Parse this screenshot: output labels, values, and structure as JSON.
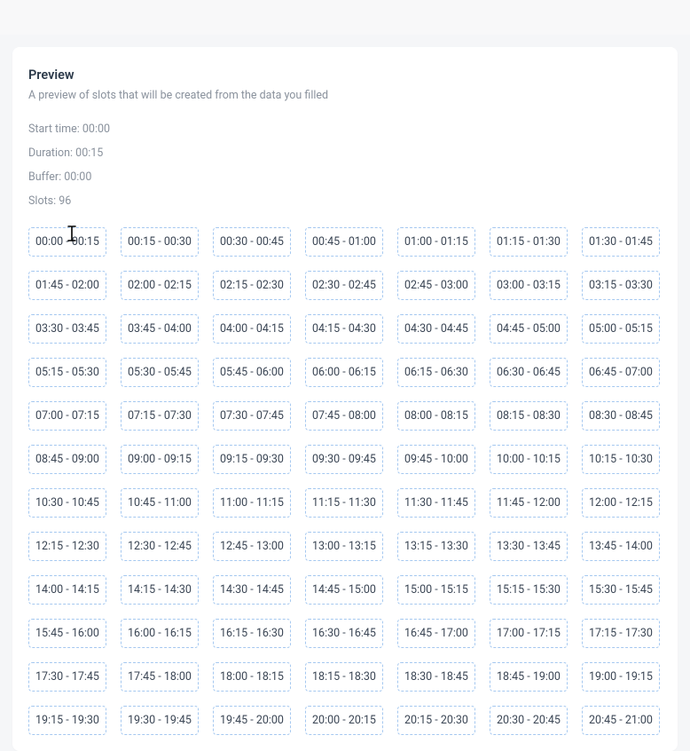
{
  "header": {
    "title": "Preview",
    "subtitle": "A preview of slots that will be created from the data you filled"
  },
  "meta": {
    "start_time_label": "Start time: 00:00",
    "duration_label": "Duration: 00:15",
    "buffer_label": "Buffer: 00:00",
    "slots_label": "Slots: 96"
  },
  "slots": [
    "00:00 - 00:15",
    "00:15 - 00:30",
    "00:30 - 00:45",
    "00:45 - 01:00",
    "01:00 - 01:15",
    "01:15 - 01:30",
    "01:30 - 01:45",
    "01:45 - 02:00",
    "02:00 - 02:15",
    "02:15 - 02:30",
    "02:30 - 02:45",
    "02:45 - 03:00",
    "03:00 - 03:15",
    "03:15 - 03:30",
    "03:30 - 03:45",
    "03:45 - 04:00",
    "04:00 - 04:15",
    "04:15 - 04:30",
    "04:30 - 04:45",
    "04:45 - 05:00",
    "05:00 - 05:15",
    "05:15 - 05:30",
    "05:30 - 05:45",
    "05:45 - 06:00",
    "06:00 - 06:15",
    "06:15 - 06:30",
    "06:30 - 06:45",
    "06:45 - 07:00",
    "07:00 - 07:15",
    "07:15 - 07:30",
    "07:30 - 07:45",
    "07:45 - 08:00",
    "08:00 - 08:15",
    "08:15 - 08:30",
    "08:30 - 08:45",
    "08:45 - 09:00",
    "09:00 - 09:15",
    "09:15 - 09:30",
    "09:30 - 09:45",
    "09:45 - 10:00",
    "10:00 - 10:15",
    "10:15 - 10:30",
    "10:30 - 10:45",
    "10:45 - 11:00",
    "11:00 - 11:15",
    "11:15 - 11:30",
    "11:30 - 11:45",
    "11:45 - 12:00",
    "12:00 - 12:15",
    "12:15 - 12:30",
    "12:30 - 12:45",
    "12:45 - 13:00",
    "13:00 - 13:15",
    "13:15 - 13:30",
    "13:30 - 13:45",
    "13:45 - 14:00",
    "14:00 - 14:15",
    "14:15 - 14:30",
    "14:30 - 14:45",
    "14:45 - 15:00",
    "15:00 - 15:15",
    "15:15 - 15:30",
    "15:30 - 15:45",
    "15:45 - 16:00",
    "16:00 - 16:15",
    "16:15 - 16:30",
    "16:30 - 16:45",
    "16:45 - 17:00",
    "17:00 - 17:15",
    "17:15 - 17:30",
    "17:30 - 17:45",
    "17:45 - 18:00",
    "18:00 - 18:15",
    "18:15 - 18:30",
    "18:30 - 18:45",
    "18:45 - 19:00",
    "19:00 - 19:15",
    "19:15 - 19:30",
    "19:30 - 19:45",
    "19:45 - 20:00",
    "20:00 - 20:15",
    "20:15 - 20:30",
    "20:30 - 20:45",
    "20:45 - 21:00"
  ]
}
